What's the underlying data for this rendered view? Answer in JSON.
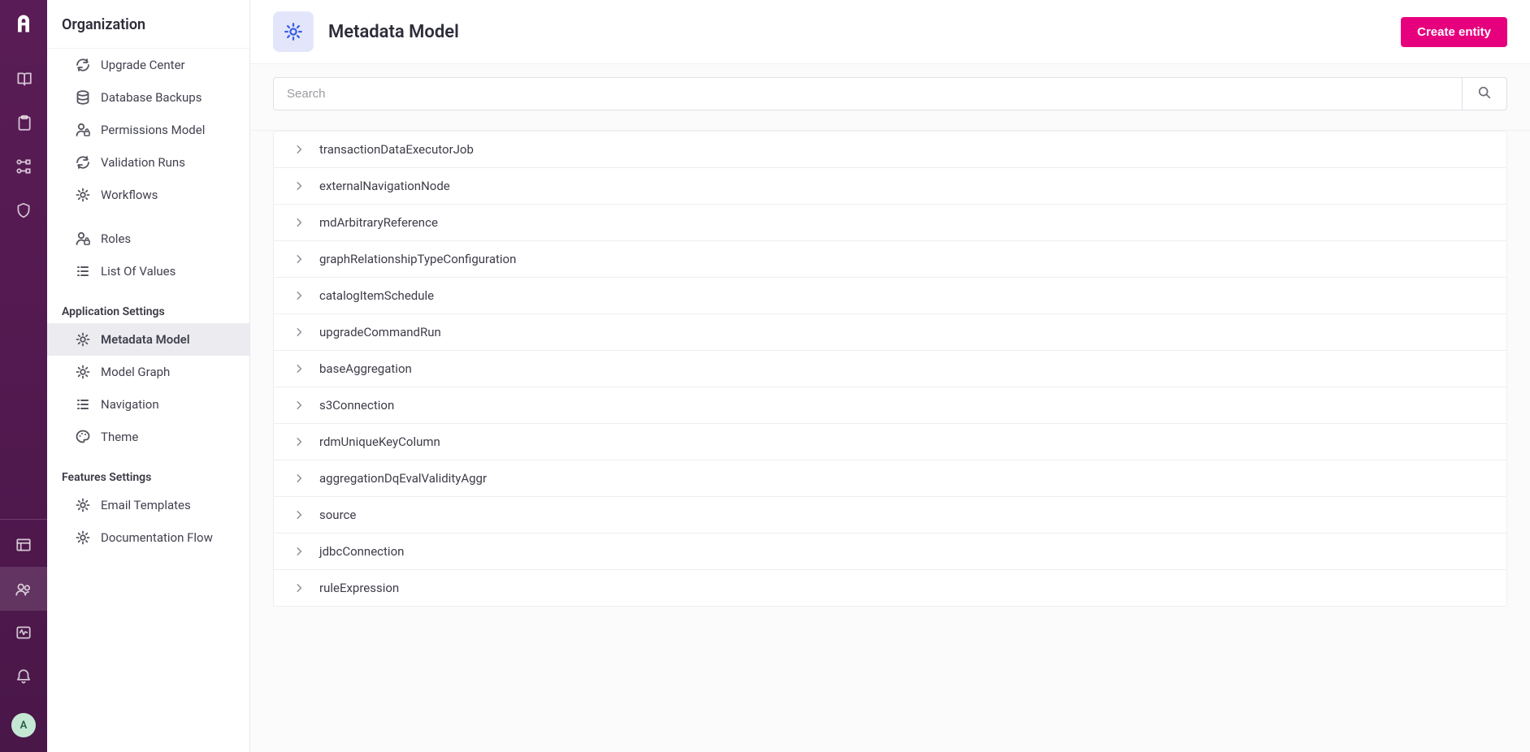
{
  "sidebar": {
    "title": "Organization",
    "items": [
      {
        "label": "Upgrade Center",
        "icon": "refresh",
        "active": false
      },
      {
        "label": "Database Backups",
        "icon": "database",
        "active": false
      },
      {
        "label": "Permissions Model",
        "icon": "user-lock",
        "active": false
      },
      {
        "label": "Validation Runs",
        "icon": "refresh",
        "active": false
      },
      {
        "label": "Workflows",
        "icon": "gear",
        "active": false
      }
    ],
    "items2": [
      {
        "label": "Roles",
        "icon": "user-lock",
        "active": false
      },
      {
        "label": "List Of Values",
        "icon": "list",
        "active": false
      }
    ],
    "section_app": "Application Settings",
    "app_items": [
      {
        "label": "Metadata Model",
        "icon": "gear",
        "active": true
      },
      {
        "label": "Model Graph",
        "icon": "gear",
        "active": false
      },
      {
        "label": "Navigation",
        "icon": "list",
        "active": false
      },
      {
        "label": "Theme",
        "icon": "palette",
        "active": false
      }
    ],
    "section_features": "Features Settings",
    "feature_items": [
      {
        "label": "Email Templates",
        "icon": "gear",
        "active": false
      },
      {
        "label": "Documentation Flow",
        "icon": "gear",
        "active": false
      }
    ]
  },
  "rail": {
    "avatar_initial": "A"
  },
  "header": {
    "title": "Metadata Model",
    "create_label": "Create entity"
  },
  "search": {
    "placeholder": "Search",
    "value": ""
  },
  "entities": [
    "transactionDataExecutorJob",
    "externalNavigationNode",
    "mdArbitraryReference",
    "graphRelationshipTypeConfiguration",
    "catalogItemSchedule",
    "upgradeCommandRun",
    "baseAggregation",
    "s3Connection",
    "rdmUniqueKeyColumn",
    "aggregationDqEvalValidityAggr",
    "source",
    "jdbcConnection",
    "ruleExpression"
  ]
}
